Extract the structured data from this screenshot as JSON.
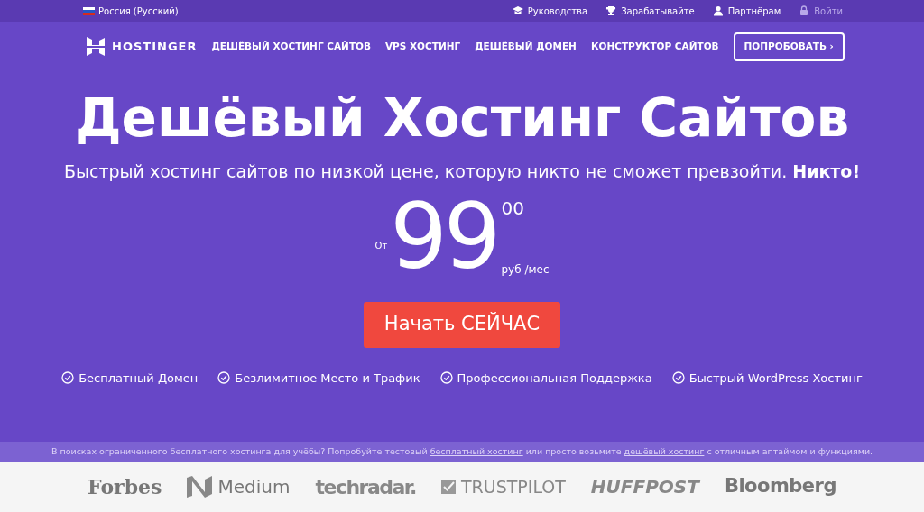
{
  "top_bar": {
    "language": "Россия (Русский)",
    "links": [
      {
        "label": "Руководства",
        "disabled": false
      },
      {
        "label": "Зарабатывайте",
        "disabled": false
      },
      {
        "label": "Партнёрам",
        "disabled": false
      },
      {
        "label": "Войти",
        "disabled": true
      }
    ]
  },
  "nav": {
    "logo": "HOSTINGER",
    "items": [
      "ДЕШЁВЫЙ ХОСТИНГ САЙТОВ",
      "VPS ХОСТИНГ",
      "ДЕШЁВЫЙ ДОМЕН",
      "КОНСТРУКТОР САЙТОВ"
    ],
    "cta": "ПОПРОБОВАТЬ ›"
  },
  "hero": {
    "title": "Дешёвый Хостинг Сайтов",
    "subtitle": "Быстрый хостинг сайтов по низкой цене, которую никто не сможет превзойти. **Никто!**",
    "price": {
      "prefix": "От",
      "amount": "99",
      "cents": "00",
      "unit": "руб /мес"
    },
    "button": "Начать СЕЙЧАС",
    "features": [
      "Бесплатный Домен",
      "Безлимитное Место и Трафик",
      "Профессиональная Поддержка",
      "Быстрый WordPress Хостинг"
    ]
  },
  "notice": [
    {
      "kind": "text",
      "text": "В поисках ограниченного бесплатного хостинга для учёбы? Попробуйте тестовый "
    },
    {
      "kind": "link",
      "text": "бесплатный хостинг"
    },
    {
      "kind": "text",
      "text": " или просто возьмите "
    },
    {
      "kind": "link",
      "text": "дешёвый хостинг"
    },
    {
      "kind": "text",
      "text": " с отличным аптаймом и функциями."
    }
  ],
  "press_logos": [
    "Forbes",
    "Medium",
    "techradar.",
    "TRUSTPILOT",
    "HUFFPOST",
    "Bloomberg"
  ]
}
